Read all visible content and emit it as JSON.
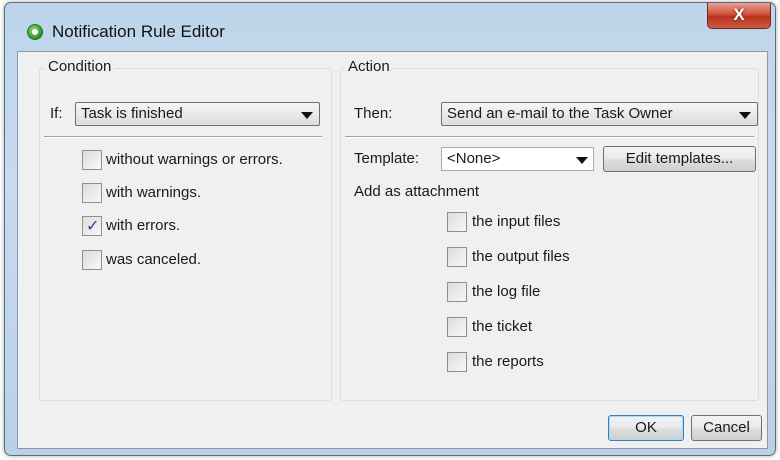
{
  "window": {
    "title": "Notification Rule Editor",
    "close_glyph": "X",
    "icon": "app-icon"
  },
  "condition": {
    "legend": "Condition",
    "if_label": "If:",
    "if_value": "Task is finished",
    "options": [
      {
        "label": "without warnings or errors.",
        "checked": false
      },
      {
        "label": "with warnings.",
        "checked": false
      },
      {
        "label": "with errors.",
        "checked": true
      },
      {
        "label": "was canceled.",
        "checked": false
      }
    ]
  },
  "action": {
    "legend": "Action",
    "then_label": "Then:",
    "then_value": "Send an e-mail to the Task Owner",
    "template_label": "Template:",
    "template_value": "<None>",
    "edit_templates_label": "Edit templates...",
    "attachment_label": "Add as attachment",
    "attachments": [
      {
        "label": "the input files",
        "checked": false
      },
      {
        "label": "the output files",
        "checked": false
      },
      {
        "label": "the log file",
        "checked": false
      },
      {
        "label": "the ticket",
        "checked": false
      },
      {
        "label": "the reports",
        "checked": false
      }
    ]
  },
  "buttons": {
    "ok": "OK",
    "cancel": "Cancel"
  },
  "check_glyph": "✓"
}
